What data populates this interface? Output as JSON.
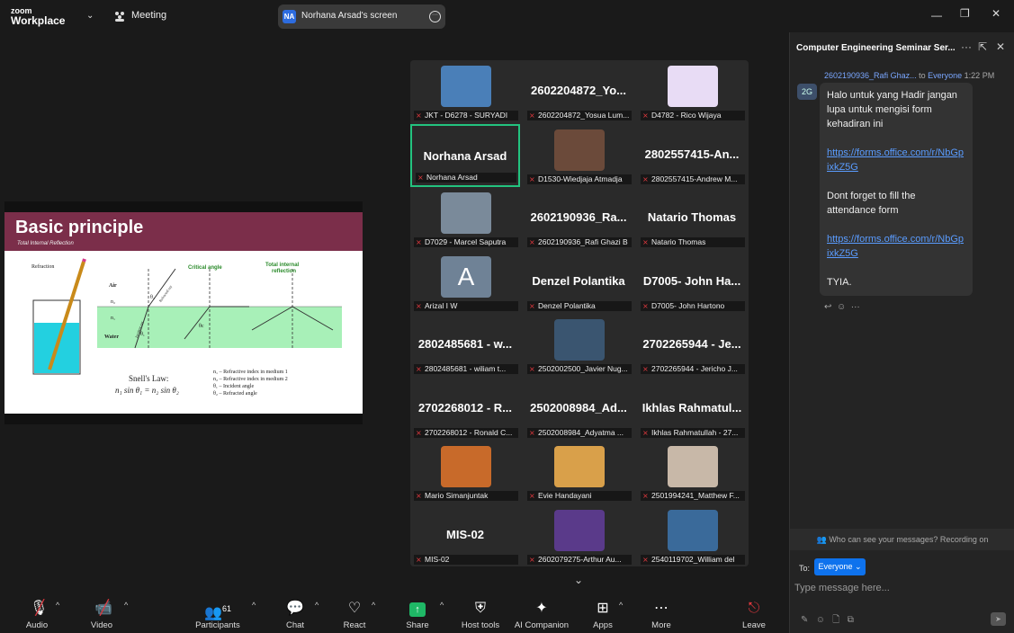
{
  "topbar": {
    "logo_line1": "zoom",
    "logo_line2": "Workplace",
    "meeting_label": "Meeting",
    "share_badge": "NA",
    "share_title": "Norhana Arsad's screen"
  },
  "slide": {
    "title": "Basic principle",
    "subtitle": "Total Internal Reflection",
    "refraction": "Refraction",
    "critical_angle": "Critical angle",
    "tir_line1": "Total internal",
    "tir_line2": "reflection",
    "air": "Air",
    "n2": "n₂",
    "n1": "n₁",
    "water": "Water",
    "theta2": "θ₂",
    "theta1": "θ₁",
    "theta_c": "θc",
    "refracted_ray": "Refracted ray",
    "incident_ray": "Incident ray",
    "snell_title": "Snell's Law:",
    "snell_eq": "n₁ sin θ₁ = n₂ sin θ₂",
    "legend": [
      "n₁ – Refractive index in medium 1",
      "n₂ – Refractive index in medium 2",
      "θ₁ – Incident angle",
      "θ₂ – Refracted angle"
    ]
  },
  "gallery": {
    "tiles": [
      {
        "big": "",
        "name": "JKT - D6278 - SURYADI",
        "thumb": "#4a7fb8"
      },
      {
        "big": "2602204872_Yo...",
        "name": "2602204872_Yosua Lum...",
        "thumb": ""
      },
      {
        "big": "",
        "name": "D4782 - Rico Wijaya",
        "thumb": "#e8dcf5"
      },
      {
        "big": "Norhana Arsad",
        "name": "Norhana Arsad",
        "thumb": "",
        "active": true
      },
      {
        "big": "",
        "name": "D1530-Wiedjaja Atmadja",
        "thumb": "#6b4a3a"
      },
      {
        "big": "2802557415-An...",
        "name": "2802557415-Andrew M...",
        "thumb": ""
      },
      {
        "big": "",
        "name": "D7029 - Marcel Saputra",
        "thumb": "#7a8a9a"
      },
      {
        "big": "2602190936_Ra...",
        "name": "2602190936_Rafi Ghazi B",
        "thumb": ""
      },
      {
        "big": "Natario Thomas",
        "name": "Natario Thomas",
        "thumb": ""
      },
      {
        "big": "",
        "name": "Arizal I W",
        "thumb": "#6f8296",
        "letter": "A"
      },
      {
        "big": "Denzel Polantika",
        "name": "Denzel Polantika",
        "thumb": ""
      },
      {
        "big": "D7005- John Ha...",
        "name": "D7005- John Hartono",
        "thumb": ""
      },
      {
        "big": "2802485681 - w...",
        "name": "2802485681 - wiliam t...",
        "thumb": ""
      },
      {
        "big": "",
        "name": "2502002500_Javier Nug...",
        "thumb": "#3a5570"
      },
      {
        "big": "2702265944 - Je...",
        "name": "2702265944 - Jericho J...",
        "thumb": ""
      },
      {
        "big": "2702268012 - R...",
        "name": "2702268012 - Ronald C...",
        "thumb": ""
      },
      {
        "big": "2502008984_Ad...",
        "name": "2502008984_Adyatma ...",
        "thumb": ""
      },
      {
        "big": "Ikhlas Rahmatul...",
        "name": "Ikhlas Rahmatullah - 27...",
        "thumb": ""
      },
      {
        "big": "",
        "name": "Mario Simanjuntak",
        "thumb": "#c86a2a"
      },
      {
        "big": "",
        "name": "Evie Handayani",
        "thumb": "#d9a04a"
      },
      {
        "big": "",
        "name": "2501994241_Matthew F...",
        "thumb": "#c8b8a8"
      },
      {
        "big": "MIS-02",
        "name": "MIS-02",
        "thumb": ""
      },
      {
        "big": "",
        "name": "2602079275-Arthur Au...",
        "thumb": "#5a3a8a"
      },
      {
        "big": "",
        "name": "2540119702_William del",
        "thumb": "#3a6a9a"
      }
    ]
  },
  "chat": {
    "title": "Computer Engineering Seminar Ser...",
    "sender": "2602190936_Rafi Ghaz...",
    "to_text": "to",
    "recipient": "Everyone",
    "time": "1:22 PM",
    "avatar": "2G",
    "line1": "Halo untuk yang Hadir jangan lupa untuk mengisi form kehadiran ini",
    "link1": "https://forms.office.com/r/NbGpixkZ5G",
    "line2": "Dont forget to fill the attendance form",
    "link2": "https://forms.office.com/r/NbGpixkZ5G",
    "line3": "TYIA.",
    "who_can_see": "Who can see your messages? Recording on",
    "to_label": "To:",
    "to_value": "Everyone",
    "input_placeholder": "Type message here..."
  },
  "toolbar": {
    "audio": "Audio",
    "video": "Video",
    "participants_count": "61",
    "participants": "Participants",
    "chat": "Chat",
    "react": "React",
    "share": "Share",
    "host_tools": "Host tools",
    "ai_companion": "AI Companion",
    "apps": "Apps",
    "more": "More",
    "leave": "Leave"
  },
  "colors": {
    "share_green": "#1fb866",
    "active_border": "#23c37f",
    "link_blue": "#5a9cff",
    "to_button": "#0e72ed",
    "leave_red": "#e0383e",
    "slide_header": "#7b2e4a",
    "water": "#23d0e0"
  }
}
